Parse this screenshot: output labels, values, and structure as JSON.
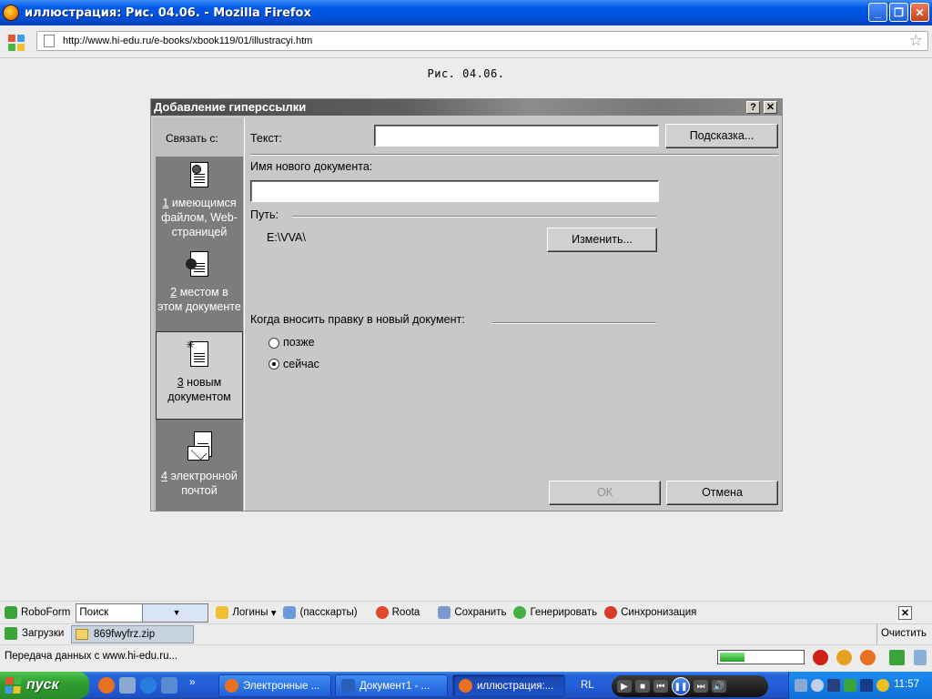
{
  "window": {
    "title": "иллюстрация: Рис. 04.06. - Mozilla Firefox",
    "buttons": {
      "minimize": "_",
      "maximize": "❐",
      "close": "✕"
    }
  },
  "nav": {
    "url": "http://www.hi-edu.ru/e-books/xbook119/01/illustracyi.htm",
    "bookmark_icon": "☆"
  },
  "page": {
    "caption": "Рис. 04.06."
  },
  "dialog": {
    "title": "Добавление гиперссылки",
    "help_btn": "?",
    "close_btn": "✕",
    "link_to_label": "Связать с:",
    "side_items": [
      {
        "num": "1",
        "text": " имеющимся файлом, Web-страницей",
        "icon": "web-page-icon"
      },
      {
        "num": "2",
        "text": " местом в этом документе",
        "icon": "place-in-document-icon"
      },
      {
        "num": "3",
        "text": " новым документом",
        "icon": "new-document-icon"
      },
      {
        "num": "4",
        "text": " электронной почтой",
        "icon": "email-icon"
      }
    ],
    "text_label": "Текст:",
    "text_value": "",
    "tip_button": "Подсказка...",
    "new_doc_label": "Имя нового документа:",
    "new_doc_value": "",
    "path_label": "Путь:",
    "path_value": "E:\\VVA\\",
    "change_button": "Изменить...",
    "when_edit_label": "Когда вносить правку в новый документ:",
    "radio_later": "позже",
    "radio_now": "сейчас",
    "ok_button": "ОК",
    "cancel_button": "Отмена"
  },
  "roboform": {
    "brand": "RoboForm",
    "search_placeholder": "Поиск",
    "logins": "Логины",
    "passcards": "(пасскарты)",
    "roota": "Roota",
    "save": "Сохранить",
    "generate": "Генерировать",
    "sync": "Синхронизация",
    "close": "✕"
  },
  "downloads": {
    "label": "Загрузки",
    "file": "869fwyfrz.zip",
    "clear": "Очистить"
  },
  "status": {
    "text": "Передача данных с www.hi-edu.ru...",
    "progress": 0.3
  },
  "taskbar": {
    "start": "пуск",
    "tasks": [
      {
        "label": "Электронные ...",
        "active": false
      },
      {
        "label": "Документ1 - ...",
        "active": false
      },
      {
        "label": "иллюстрация:...",
        "active": true
      }
    ],
    "lang": "RL",
    "more": "»",
    "clock": "11:57"
  },
  "colors": {
    "taskbar": "#245edb",
    "start": "#2f9e2f",
    "dialog_bg": "#c8c8c8",
    "sidebar_bg": "#7c7c7c"
  }
}
